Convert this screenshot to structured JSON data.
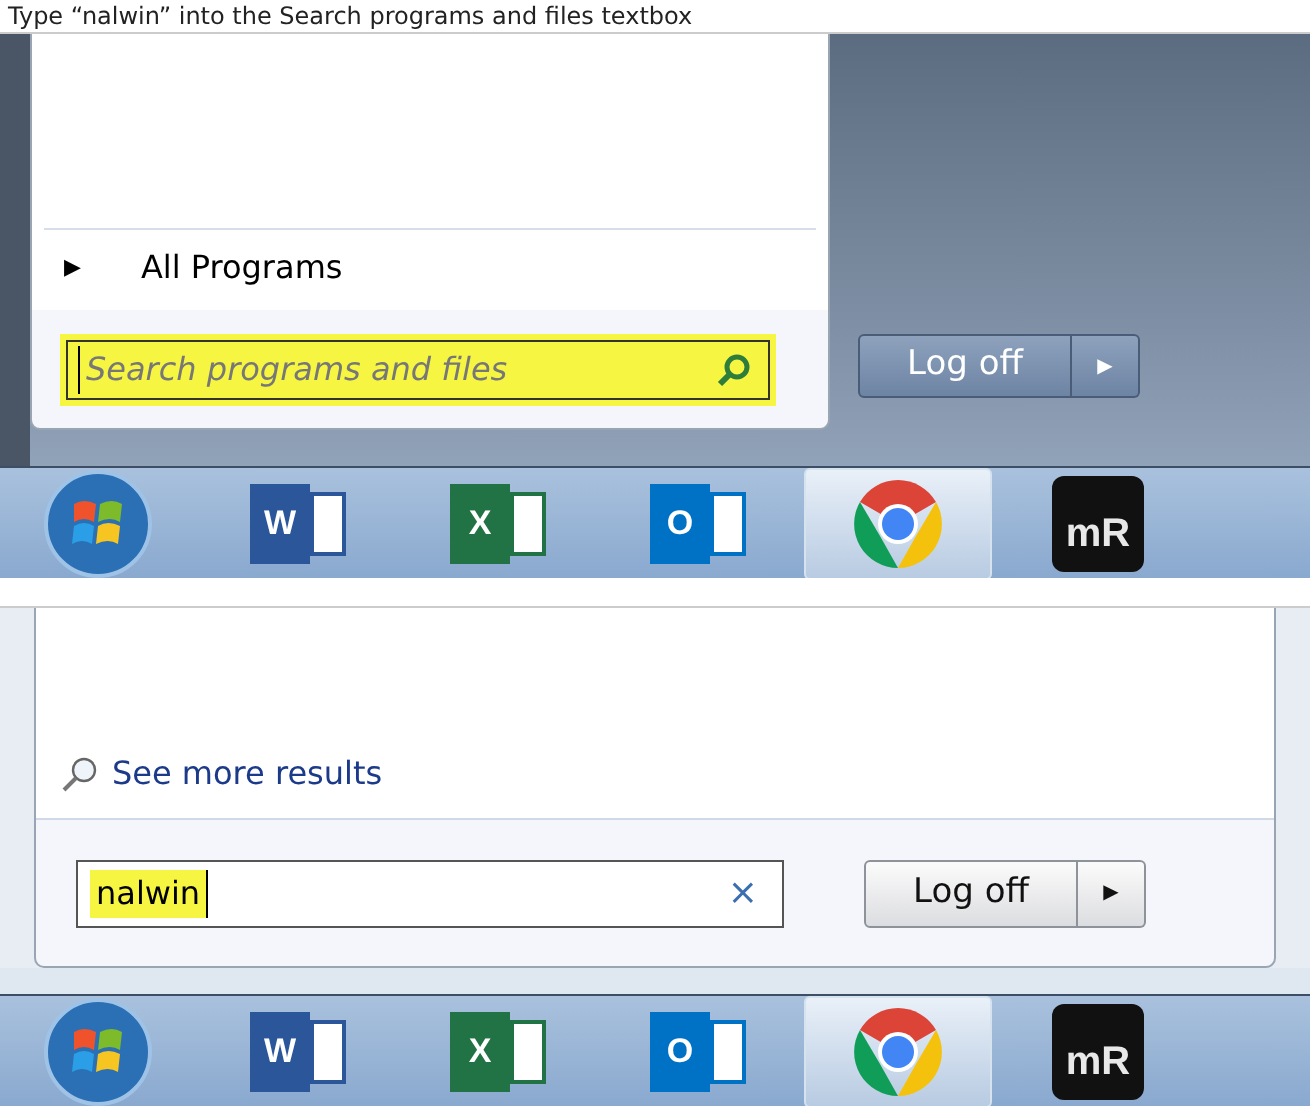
{
  "caption": "Type “nalwin” into the Search programs and files textbox",
  "panels": [
    {
      "kind": "empty_search",
      "menu_item": {
        "arrow": "▶",
        "label": "All Programs"
      },
      "search": {
        "placeholder": "Search programs and files",
        "highlighted": true
      },
      "logoff": {
        "label": "Log off",
        "arrow": "▶"
      },
      "taskbar": [
        {
          "kind": "orb",
          "selected": false
        },
        {
          "kind": "word",
          "label": "W",
          "selected": false
        },
        {
          "kind": "excel",
          "label": "X",
          "selected": false
        },
        {
          "kind": "outlook",
          "label": "O",
          "selected": false
        },
        {
          "kind": "browser",
          "selected": true
        },
        {
          "kind": "mr",
          "label": "mR",
          "selected": false
        }
      ]
    },
    {
      "kind": "typed_search",
      "more_results": "See more results",
      "search": {
        "value": "nalwin",
        "highlighted": true,
        "clear": "×"
      },
      "logoff": {
        "label": "Log off",
        "arrow": "▶"
      },
      "taskbar": [
        {
          "kind": "orb",
          "selected": false
        },
        {
          "kind": "word",
          "label": "W",
          "selected": false
        },
        {
          "kind": "excel",
          "label": "X",
          "selected": false
        },
        {
          "kind": "outlook",
          "label": "O",
          "selected": false
        },
        {
          "kind": "browser",
          "selected": true
        },
        {
          "kind": "mr",
          "label": "mR",
          "selected": false
        }
      ]
    }
  ]
}
